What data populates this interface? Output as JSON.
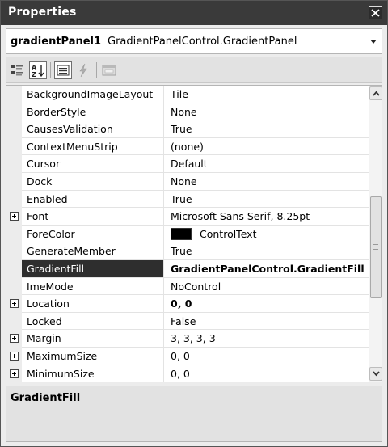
{
  "window": {
    "title": "Properties"
  },
  "object_selector": {
    "name": "gradientPanel1",
    "type": "GradientPanelControl.GradientPanel"
  },
  "toolbar": {
    "buttons": [
      {
        "icon": "categorized-icon",
        "active": false
      },
      {
        "icon": "alphabetical-icon",
        "active": true
      },
      {
        "icon": "properties-icon",
        "active": true
      },
      {
        "icon": "events-lightning-icon",
        "active": false
      },
      {
        "icon": "property-pages-icon",
        "active": false
      }
    ]
  },
  "properties": [
    {
      "name": "BackgroundImageLayout",
      "value": "Tile"
    },
    {
      "name": "BorderStyle",
      "value": "None"
    },
    {
      "name": "CausesValidation",
      "value": "True"
    },
    {
      "name": "ContextMenuStrip",
      "value": "(none)"
    },
    {
      "name": "Cursor",
      "value": "Default"
    },
    {
      "name": "Dock",
      "value": "None"
    },
    {
      "name": "Enabled",
      "value": "True"
    },
    {
      "name": "Font",
      "value": "Microsoft Sans Serif, 8.25pt",
      "expandable": true
    },
    {
      "name": "ForeColor",
      "value": "ControlText",
      "swatch_color": "#000000"
    },
    {
      "name": "GenerateMember",
      "value": "True"
    },
    {
      "name": "GradientFill",
      "value": "GradientPanelControl.GradientFill",
      "bold": true,
      "selected": true
    },
    {
      "name": "ImeMode",
      "value": "NoControl"
    },
    {
      "name": "Location",
      "value": "0, 0",
      "bold": true,
      "expandable": true
    },
    {
      "name": "Locked",
      "value": "False"
    },
    {
      "name": "Margin",
      "value": "3, 3, 3, 3",
      "expandable": true
    },
    {
      "name": "MaximumSize",
      "value": "0, 0",
      "expandable": true
    },
    {
      "name": "MinimumSize",
      "value": "0, 0",
      "expandable": true
    }
  ],
  "description": {
    "title": "GradientFill",
    "text": ""
  },
  "colors": {
    "titlebar": "#3a3a3a",
    "selection": "#2e2e2e",
    "panel": "#ececec"
  }
}
